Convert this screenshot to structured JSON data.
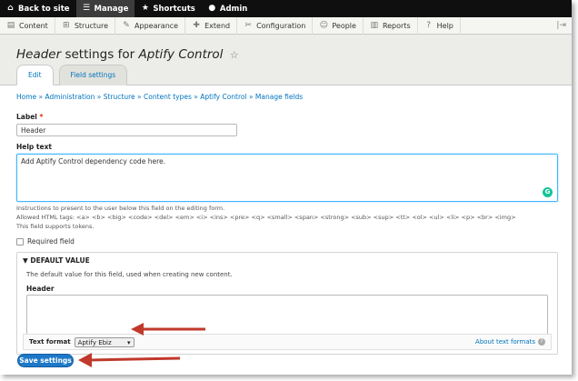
{
  "toolbar": {
    "back": "Back to site",
    "manage": "Manage",
    "shortcuts": "Shortcuts",
    "admin": "Admin"
  },
  "menu": {
    "items": [
      "Content",
      "Structure",
      "Appearance",
      "Extend",
      "Configuration",
      "People",
      "Reports",
      "Help"
    ]
  },
  "page": {
    "title_prefix": "Header",
    "title_middle": "settings for",
    "title_entity": "Aptify Control",
    "tabs": [
      "Edit",
      "Field settings"
    ]
  },
  "breadcrumb": "Home » Administration » Structure » Content types » Aptify Control » Manage fields",
  "form": {
    "label_title": "Label",
    "label_required_mark": "*",
    "label_value": "Header",
    "help_title": "Help text",
    "help_value": "Add Aptify Control dependency code here.",
    "help_desc_1": "Instructions to present to the user below this field on the editing form.",
    "help_desc_2": "Allowed HTML tags: <a> <b> <big> <code> <del> <em> <i> <ins> <pre> <q> <small> <span> <strong> <sub> <sup> <tt> <ol> <ul> <li> <p> <br> <img>",
    "help_desc_3": "This field supports tokens.",
    "required_label": "Required field",
    "default_summary": "▼ DEFAULT VALUE",
    "default_desc": "The default value for this field, used when creating new content.",
    "default_field_label": "Header",
    "text_format_label": "Text format",
    "text_format_value": "Aptify Ebiz",
    "about_formats": "About text formats",
    "save": "Save settings"
  }
}
